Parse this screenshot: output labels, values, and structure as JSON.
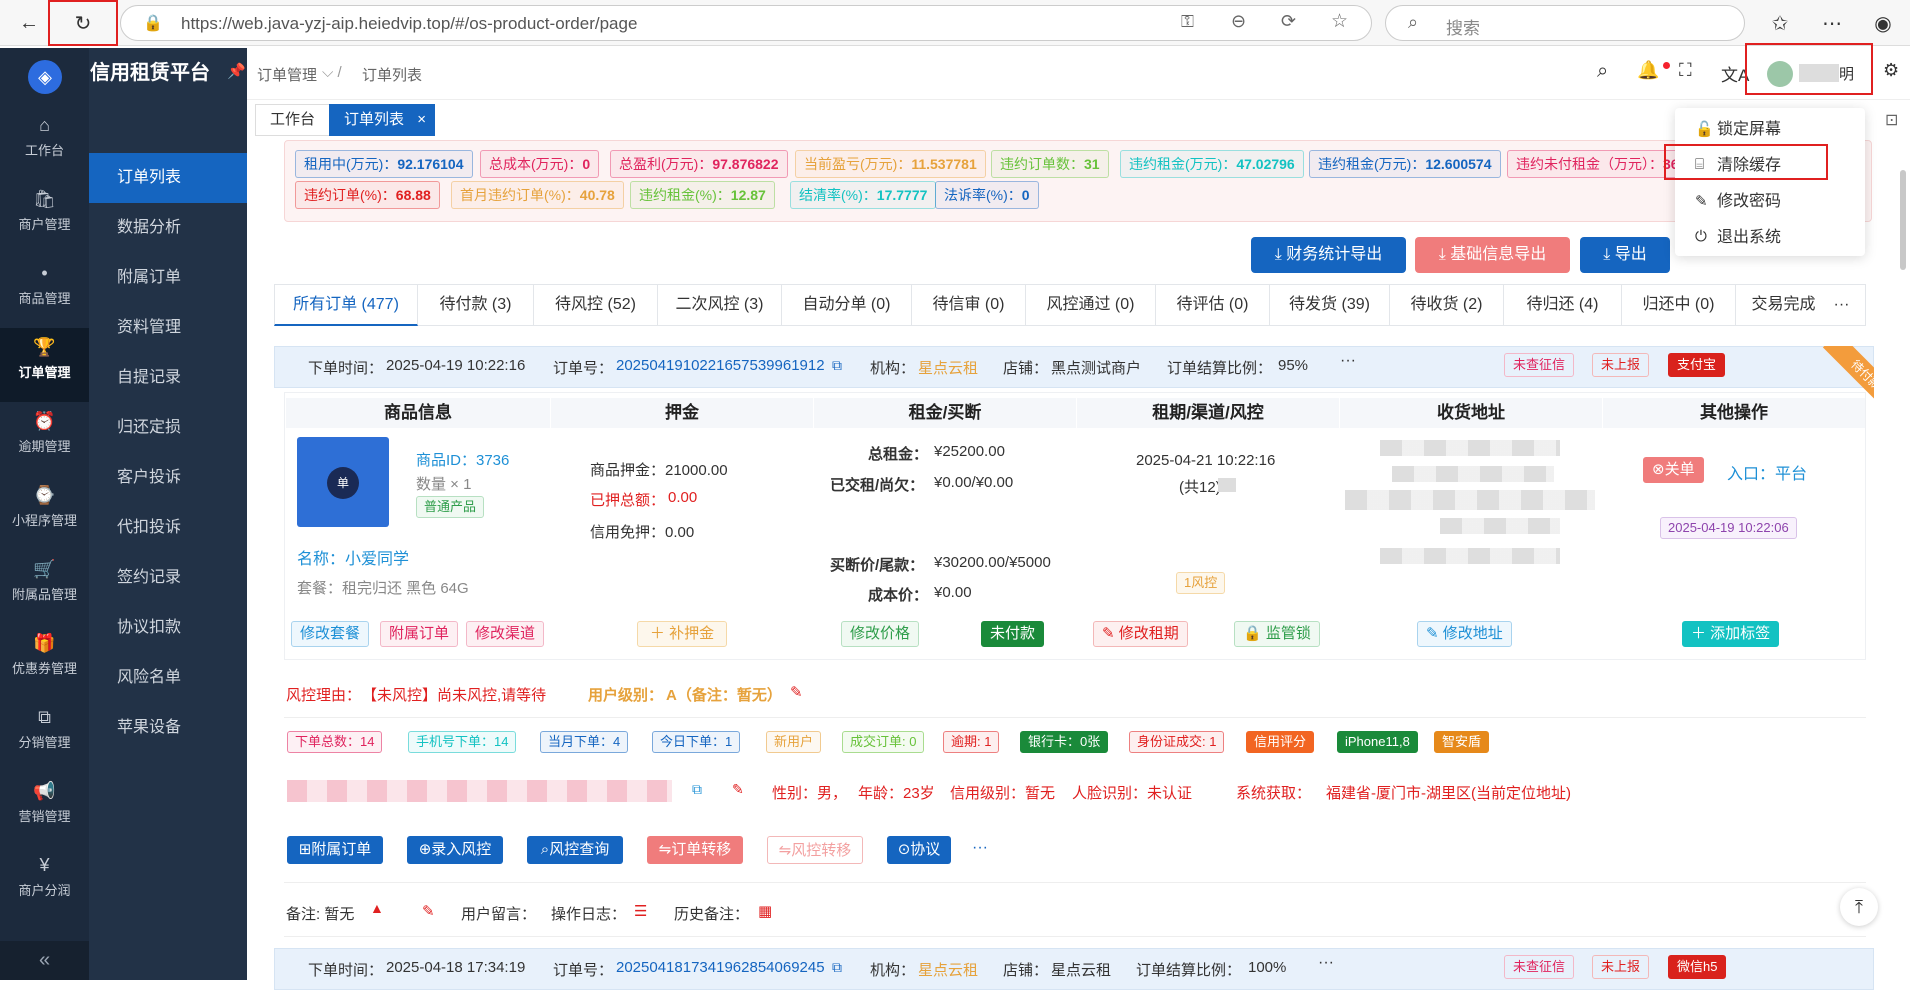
{
  "browser": {
    "url": "https://web.java-yzj-aip.heiedvip.top/#/os-product-order/page",
    "search_placeholder": "搜索"
  },
  "app": {
    "title": "信用租赁平台"
  },
  "sidebar": {
    "items": [
      {
        "label": "工作台",
        "icon": "home-icon"
      },
      {
        "label": "商户管理",
        "icon": "shop-icon"
      },
      {
        "label": "商品管理",
        "icon": "apple-icon"
      },
      {
        "label": "订单管理",
        "icon": "trophy-icon"
      },
      {
        "label": "逾期管理",
        "icon": "alarm-icon"
      },
      {
        "label": "小程序管理",
        "icon": "watch-icon"
      },
      {
        "label": "附属品管理",
        "icon": "cart-icon"
      },
      {
        "label": "优惠券管理",
        "icon": "gift-icon"
      },
      {
        "label": "分销管理",
        "icon": "distribution-icon"
      },
      {
        "label": "营销管理",
        "icon": "megaphone-icon"
      },
      {
        "label": "商户分润",
        "icon": "yen-icon"
      }
    ],
    "collapse": "«"
  },
  "submenu": {
    "items": [
      "订单列表",
      "数据分析",
      "附属订单",
      "资料管理",
      "自提记录",
      "归还定损",
      "客户投诉",
      "代扣投诉",
      "签约记录",
      "协议扣款",
      "风险名单",
      "苹果设备"
    ]
  },
  "breadcrumb": {
    "parent": "订单管理",
    "current": "订单列表"
  },
  "header": {
    "user_suffix": "明"
  },
  "tabs": [
    {
      "label": "工作台"
    },
    {
      "label": "订单列表",
      "close": "×"
    }
  ],
  "dropdown": {
    "items": [
      "锁定屏幕",
      "清除缓存",
      "修改密码",
      "退出系统"
    ]
  },
  "stats": [
    {
      "label": "租用中(万元)：",
      "value": "92.176104",
      "color": "#1565c0"
    },
    {
      "label": "总成本(万元)：",
      "value": "0",
      "color": "#e0245e"
    },
    {
      "label": "总盈利(万元)：",
      "value": "97.876822",
      "color": "#e0245e"
    },
    {
      "label": "当前盈亏(万元)：",
      "value": "11.537781",
      "color": "#e6a23c"
    },
    {
      "label": "违约订单数：",
      "value": "31",
      "color": "#67c23a"
    },
    {
      "label": "违约租金(万元)：",
      "value": "47.02796",
      "color": "#13c2c2"
    },
    {
      "label": "违约租金(万元)：",
      "value": "12.600574",
      "color": "#1565c0"
    },
    {
      "label": "违约未付租金（万元）：",
      "value": "36",
      "color": "#e0245e"
    },
    {
      "label": "违约订单(%)：",
      "value": "68.88",
      "color": "#e02020"
    },
    {
      "label": "首月违约订单(%)：",
      "value": "40.78",
      "color": "#e6a23c"
    },
    {
      "label": "违约租金(%)：",
      "value": "12.87",
      "color": "#67c23a"
    },
    {
      "label": "结清率(%)：",
      "value": "17.7777",
      "color": "#13c2c2"
    },
    {
      "label": "法诉率(%)：",
      "value": "0",
      "color": "#1565c0"
    }
  ],
  "exports": {
    "finance": "财务统计导出",
    "basic": "基础信息导出",
    "export": "导出"
  },
  "order_tabs": [
    "所有订单 (477)",
    "待付款 (3)",
    "待风控 (52)",
    "二次风控 (3)",
    "自动分单 (0)",
    "待信审 (0)",
    "风控通过 (0)",
    "待评估 (0)",
    "待发货 (39)",
    "待收货 (2)",
    "待归还 (4)",
    "归还中 (0)",
    "交易完成"
  ],
  "order1": {
    "time_label": "下单时间：",
    "time": "2025-04-19 10:22:16",
    "no_label": "订单号：",
    "no": "20250419102216575399619​12",
    "org_label": "机构：",
    "org": "星点云租",
    "shop_label": "店铺：",
    "shop": "黑点测试商户",
    "ratio_label": "订单结算比例：",
    "ratio": "95%",
    "tags": [
      "未查征信",
      "未上报",
      "支付宝"
    ],
    "corner": "待付款",
    "cols": [
      "商品信息",
      "押金",
      "租金/买断",
      "租期/渠道/风控",
      "收货地址",
      "其他操作"
    ],
    "product": {
      "thumb": "单",
      "id": "商品ID：3736",
      "qty": "数量 × 1",
      "type": "普通产品",
      "name": "名称：小爱同学",
      "package": "套餐：租完归还 黑色 64G"
    },
    "deposit": {
      "product": "商品押金：21000.00",
      "paid_label": "已押总额：",
      "paid": "0.00",
      "credit": "信用免押：0.00"
    },
    "rent": {
      "total_label": "总租金：",
      "total": "¥25200.00",
      "paid_label": "已交租/尚欠：",
      "paid": "¥0.00/¥0.00",
      "buyout_label": "买断价/尾款：",
      "buyout": "¥30200.00/¥5000",
      "cost_label": "成本价：",
      "cost": "¥0.00"
    },
    "term": {
      "date": "2025-04-21 10:22:16",
      "count": "(共12)",
      "risk": "1风控"
    },
    "ops": {
      "close": "⊗关单",
      "entry": "入口：平台",
      "created": "2025-04-19 10:22:06"
    },
    "buttons": {
      "modify_package": "修改套餐",
      "sub_order": "附属订单",
      "modify_channel": "修改渠道",
      "add_deposit": "＋ 补押金",
      "modify_price": "修改价格",
      "unpaid": "未付款",
      "modify_term": "修改租期",
      "monitor": "监管锁",
      "modify_address": "修改地址",
      "add_tag": "＋ 添加标签"
    },
    "risk_reason_label": "风控理由：",
    "risk_reason": "【未风控】尚未风控,请等待",
    "user_level_label": "用户级别：",
    "user_level": "A（备注：暂无）",
    "mini_tags": [
      {
        "t": "下单总数：14",
        "c": "#e0245e"
      },
      {
        "t": "手机号下单：14",
        "c": "#13c2c2"
      },
      {
        "t": "当月下单：4",
        "c": "#1565c0"
      },
      {
        "t": "今日下单：1",
        "c": "#1565c0"
      },
      {
        "t": "新用户",
        "c": "#e6a23c"
      },
      {
        "t": "成交订单: 0",
        "c": "#67c23a"
      },
      {
        "t": "逾期: 1",
        "c": "#e02020"
      },
      {
        "t": "银行卡：0张",
        "c": "#fff",
        "bg": "#1a8a3a"
      },
      {
        "t": "身份证成交: 1",
        "c": "#e02020"
      },
      {
        "t": "信用评分",
        "c": "#fff",
        "bg": "#f26522"
      },
      {
        "t": "iPhone11,8",
        "c": "#fff",
        "bg": "#1a8a3a"
      },
      {
        "t": "智安盾",
        "c": "#fff",
        "bg": "#e6891a"
      }
    ],
    "user": {
      "gender": "性别：男，",
      "age": "年龄：23岁",
      "credit": "信用级别：暂无",
      "face": "人脸识别：未认证",
      "sys_label": "系统获取：",
      "location": "福建省-厦门市-湖里区(当前定位地址)"
    },
    "actions": [
      "附属订单",
      "录入风控",
      "风控查询",
      "订单转移",
      "风控转移",
      "协议",
      "···"
    ],
    "remark": {
      "label": "备注: 暂无",
      "message": "用户留言：",
      "log": "操作日志：",
      "history": "历史备注："
    }
  },
  "order2": {
    "time_label": "下单时间：",
    "time": "2025-04-18 17:34:19",
    "no_label": "订单号：",
    "no": "20250418173419628540692​45",
    "org_label": "机构：",
    "org": "星点云租",
    "shop_label": "店铺：",
    "shop": "星点云租",
    "ratio_label": "订单结算比例：",
    "ratio": "100%",
    "tags": [
      "未查征信",
      "未上报",
      "微信h5"
    ]
  }
}
